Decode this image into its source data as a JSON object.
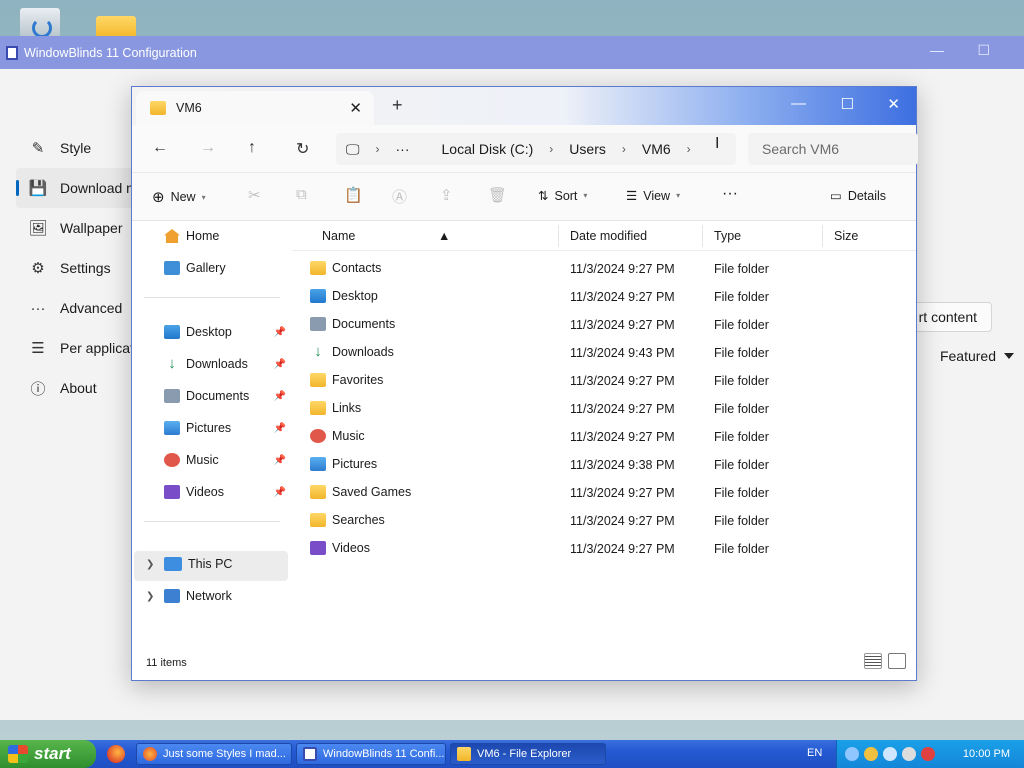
{
  "wb": {
    "title": "WindowBlinds 11 Configuration",
    "nav": [
      {
        "label": "Style",
        "icon": "brush-icon"
      },
      {
        "label": "Download m",
        "icon": "download-save-icon",
        "active": true
      },
      {
        "label": "Wallpaper",
        "icon": "image-icon"
      },
      {
        "label": "Settings",
        "icon": "gear-icon"
      },
      {
        "label": "Advanced",
        "icon": "more-icon"
      },
      {
        "label": "Per applicat",
        "icon": "list-icon"
      },
      {
        "label": "About",
        "icon": "info-icon"
      }
    ],
    "content_button": "rt content",
    "featured": "Featured"
  },
  "explorer": {
    "tab_title": "VM6",
    "breadcrumb": {
      "more": "···",
      "items": [
        "Local Disk (C:)",
        "Users",
        "VM6"
      ]
    },
    "search_placeholder": "Search VM6",
    "cmd": {
      "new": "New",
      "sort": "Sort",
      "view": "View",
      "more": "···",
      "details": "Details"
    },
    "sidebar": {
      "home": "Home",
      "gallery": "Gallery",
      "pinned": [
        "Desktop",
        "Downloads",
        "Documents",
        "Pictures",
        "Music",
        "Videos"
      ],
      "this_pc": "This PC",
      "network": "Network"
    },
    "columns": {
      "name": "Name",
      "date": "Date modified",
      "type": "Type",
      "size": "Size"
    },
    "rows": [
      {
        "name": "Contacts",
        "date": "11/3/2024 9:27 PM",
        "type": "File folder",
        "icon": "folder-icon"
      },
      {
        "name": "Desktop",
        "date": "11/3/2024 9:27 PM",
        "type": "File folder",
        "icon": "desktop-icon"
      },
      {
        "name": "Documents",
        "date": "11/3/2024 9:27 PM",
        "type": "File folder",
        "icon": "documents-icon"
      },
      {
        "name": "Downloads",
        "date": "11/3/2024 9:43 PM",
        "type": "File folder",
        "icon": "download-icon"
      },
      {
        "name": "Favorites",
        "date": "11/3/2024 9:27 PM",
        "type": "File folder",
        "icon": "folder-icon"
      },
      {
        "name": "Links",
        "date": "11/3/2024 9:27 PM",
        "type": "File folder",
        "icon": "folder-icon"
      },
      {
        "name": "Music",
        "date": "11/3/2024 9:27 PM",
        "type": "File folder",
        "icon": "music-icon"
      },
      {
        "name": "Pictures",
        "date": "11/3/2024 9:38 PM",
        "type": "File folder",
        "icon": "pictures-icon"
      },
      {
        "name": "Saved Games",
        "date": "11/3/2024 9:27 PM",
        "type": "File folder",
        "icon": "folder-icon"
      },
      {
        "name": "Searches",
        "date": "11/3/2024 9:27 PM",
        "type": "File folder",
        "icon": "folder-icon"
      },
      {
        "name": "Videos",
        "date": "11/3/2024 9:27 PM",
        "type": "File folder",
        "icon": "videos-icon"
      }
    ],
    "status": "11 items"
  },
  "taskbar": {
    "start": "start",
    "tasks": [
      "Just some Styles I mad...",
      "WindowBlinds 11 Confi...",
      "VM6 - File Explorer"
    ],
    "lang": "EN",
    "clock": "10:00 PM"
  }
}
